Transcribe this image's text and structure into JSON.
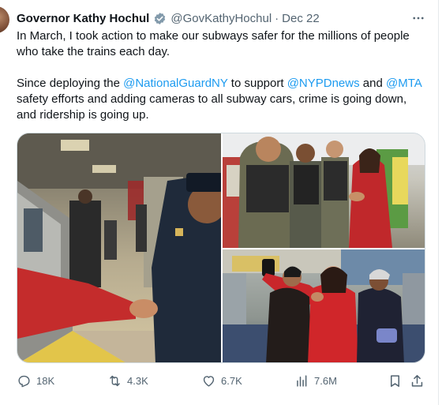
{
  "author": {
    "name": "Governor Kathy Hochul",
    "handle": "@GovKathyHochul",
    "separator": "·",
    "date": "Dec 22",
    "verified": true
  },
  "tweet": {
    "p1": "In March, I took action to make our subways safer for the millions of people who take the trains each day.",
    "p2_before": "Since deploying the ",
    "mention1": "@NationalGuardNY",
    "p2_mid1": " to support ",
    "mention2": "@NYPDnews",
    "p2_mid2": " and ",
    "mention3": "@MTA",
    "p2_after": " safety efforts and adding cameras to all subway cars, crime is going down, and ridership is going up."
  },
  "stats": {
    "replies": "18K",
    "reposts": "4.3K",
    "likes": "6.7K",
    "views": "7.6M"
  },
  "icons": {
    "more": "more-horizontal-icon",
    "reply": "reply-icon",
    "repost": "repost-icon",
    "like": "heart-icon",
    "views": "views-icon",
    "bookmark": "bookmark-icon",
    "share": "share-icon"
  },
  "colors": {
    "text": "#0f1419",
    "muted": "#536471",
    "link": "#1d9bf0",
    "verified_badge": "#829aab"
  }
}
